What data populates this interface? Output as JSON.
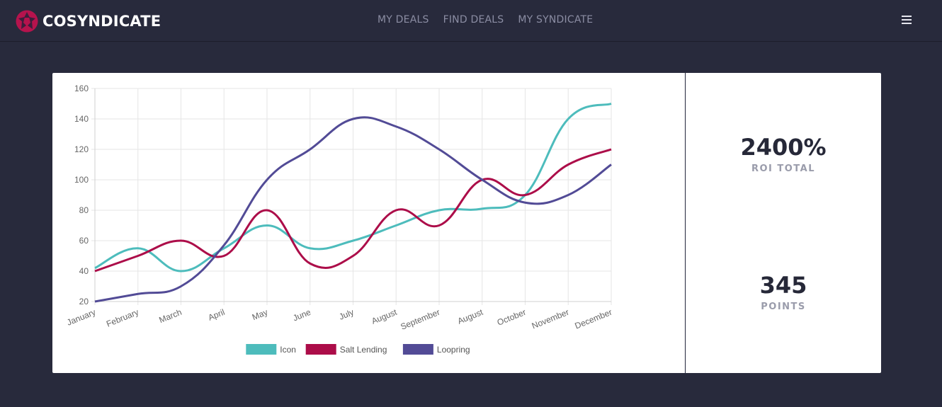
{
  "header": {
    "brand": "COSYNDICATE",
    "nav": [
      "MY DEALS",
      "FIND DEALS",
      "MY SYNDICATE"
    ]
  },
  "stats": [
    {
      "value": "2400%",
      "label": "ROI TOTAL"
    },
    {
      "value": "345",
      "label": "POINTS"
    }
  ],
  "colors": {
    "background": "#282a3c",
    "brand_accent": "#b5134d",
    "icon": "#4dbcbc",
    "salt_lending": "#ac0d49",
    "loopring": "#524b96"
  },
  "chart_data": {
    "type": "line",
    "categories": [
      "January",
      "February",
      "March",
      "April",
      "May",
      "June",
      "July",
      "August",
      "September",
      "August",
      "October",
      "November",
      "December"
    ],
    "series": [
      {
        "name": "Icon",
        "color": "#4dbcbc",
        "values": [
          42,
          55,
          40,
          55,
          70,
          55,
          60,
          70,
          80,
          81,
          90,
          140,
          150
        ]
      },
      {
        "name": "Salt Lending",
        "color": "#ac0d49",
        "values": [
          40,
          50,
          60,
          50,
          80,
          45,
          50,
          80,
          70,
          100,
          90,
          110,
          120
        ]
      },
      {
        "name": "Loopring",
        "color": "#524b96",
        "values": [
          20,
          25,
          30,
          57,
          100,
          120,
          140,
          135,
          120,
          100,
          85,
          90,
          110
        ]
      }
    ],
    "ylim": [
      20,
      160
    ],
    "yticks": [
      160,
      140,
      120,
      100,
      80,
      60,
      40,
      20
    ],
    "grid": true,
    "legend": "bottom"
  }
}
